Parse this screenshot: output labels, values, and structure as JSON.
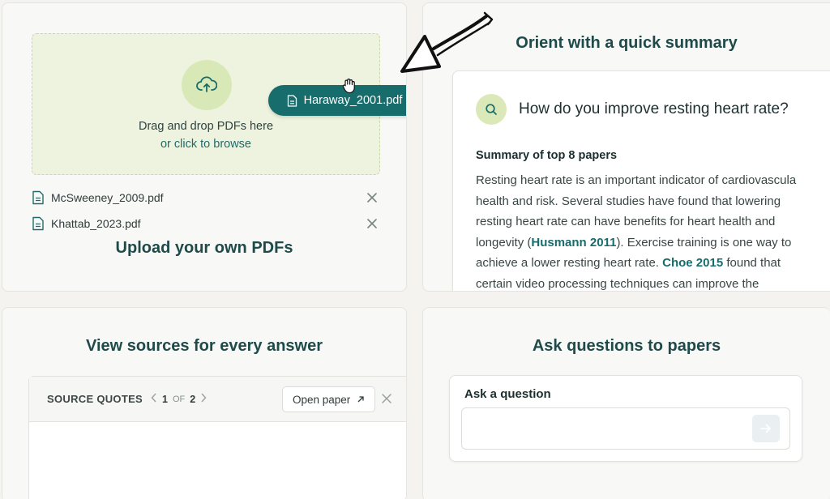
{
  "upload_card": {
    "dropzone": {
      "line1": "Drag and drop PDFs here",
      "line2": "or click to browse"
    },
    "dragged_file": "Haraway_2001.pdf",
    "files": [
      {
        "name": "McSweeney_2009.pdf"
      },
      {
        "name": "Khattab_2023.pdf"
      }
    ],
    "title": "Upload your own PDFs"
  },
  "summary_card": {
    "title": "Orient with a quick summary",
    "question": "How do you improve resting heart rate?",
    "heading": "Summary of top 8 papers",
    "lines": [
      "Resting heart rate is an important indicator of cardiovascula",
      "health and risk. Several studies have found that lowering",
      "resting heart rate can have benefits for heart health and"
    ],
    "line4_pre": "longevity (",
    "cite1": "Husmann 2011",
    "line4_post": "). Exercise training is one way to",
    "line5_pre": "achieve a lower resting heart rate. ",
    "cite2": "Choe 2015",
    "line5_post": " found that",
    "line6": "certain video processing techniques can improve the"
  },
  "sources_card": {
    "title": "View sources for every answer",
    "label": "SOURCE QUOTES",
    "page_current": "1",
    "page_of": "OF",
    "page_total": "2",
    "open_paper": "Open paper"
  },
  "ask_card": {
    "title": "Ask questions to papers",
    "label": "Ask a question",
    "placeholder": ""
  },
  "colors": {
    "accent": "#176c6c",
    "dropzone_bg": "#eef3df",
    "badge_green": "#d8e9b7"
  }
}
